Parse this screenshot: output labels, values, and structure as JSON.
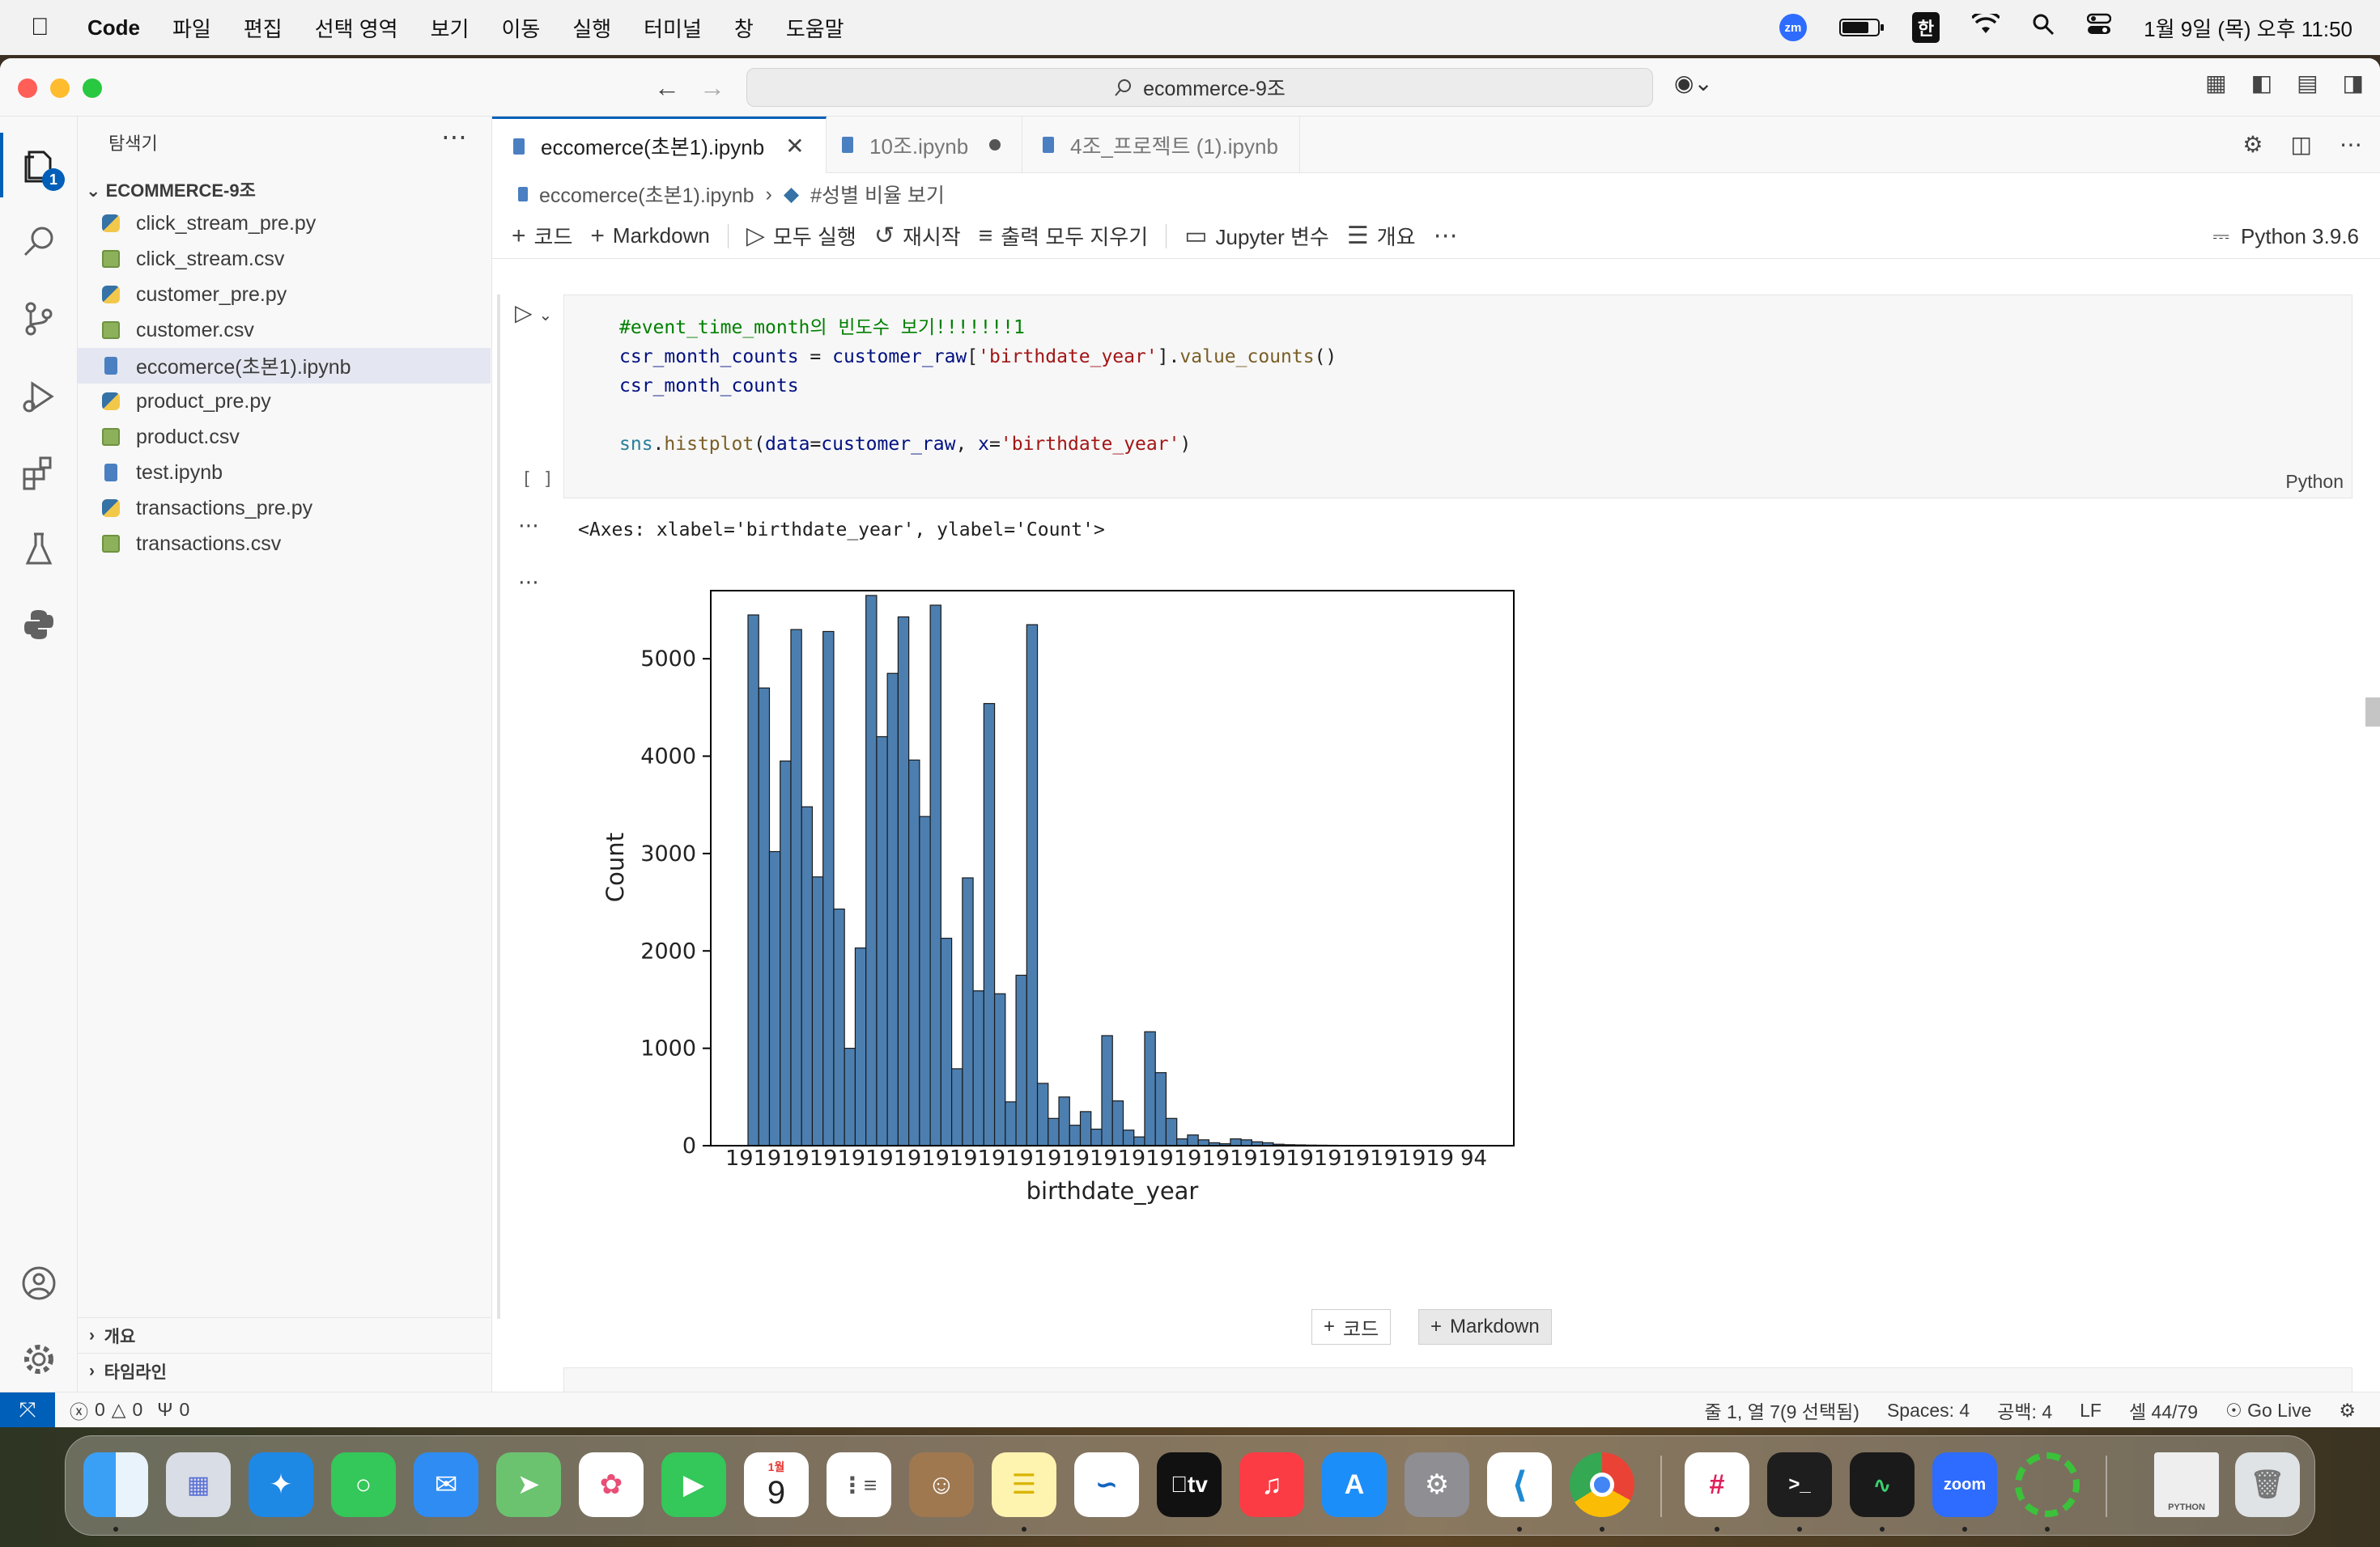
{
  "menubar": {
    "app": "Code",
    "items": [
      "파일",
      "편집",
      "선택 영역",
      "보기",
      "이동",
      "실행",
      "터미널",
      "창",
      "도움말"
    ],
    "zoom_badge": "zm",
    "input_method": "한",
    "datetime": "1월 9일 (목) 오후 11:50"
  },
  "titlebar": {
    "search": "ecommerce-9조"
  },
  "activity": {
    "explorer_badge": "1"
  },
  "sidebar": {
    "title": "탐색기",
    "folder": "ECOMMERCE-9조",
    "files": [
      {
        "name": "click_stream_pre.py",
        "type": "py"
      },
      {
        "name": "click_stream.csv",
        "type": "csv"
      },
      {
        "name": "customer_pre.py",
        "type": "py"
      },
      {
        "name": "customer.csv",
        "type": "csv"
      },
      {
        "name": "eccomerce(초본1).ipynb",
        "type": "nb"
      },
      {
        "name": "product_pre.py",
        "type": "py"
      },
      {
        "name": "product.csv",
        "type": "csv"
      },
      {
        "name": "test.ipynb",
        "type": "nb"
      },
      {
        "name": "transactions_pre.py",
        "type": "py"
      },
      {
        "name": "transactions.csv",
        "type": "csv"
      }
    ],
    "sections": [
      "개요",
      "타임라인"
    ]
  },
  "tabs": [
    {
      "label": "eccomerce(초본1).ipynb",
      "active": true
    },
    {
      "label": "10조.ipynb",
      "dirty": true
    },
    {
      "label": "4조_프로젝트 (1).ipynb"
    }
  ],
  "breadcrumb": {
    "file": "eccomerce(초본1).ipynb",
    "section": "#성별 비율 보기"
  },
  "toolbar": {
    "code": "코드",
    "markdown": "Markdown",
    "run_all": "모두 실행",
    "restart": "재시작",
    "clear_outputs": "출력 모두 지우기",
    "variables": "Jupyter 변수",
    "outline": "개요",
    "kernel": "Python 3.9.6"
  },
  "cell": {
    "line1": "#event_time_month의 빈도수 보기!!!!!!!1",
    "line2_var": "csr_month_counts",
    "line2_eq": " = ",
    "line2_obj": "customer_raw",
    "line2_open": "[",
    "line2_key": "'birthdate_year'",
    "line2_close": "].",
    "line2_fn": "value_counts",
    "line2_call": "()",
    "line3": "csr_month_counts",
    "line5_mod": "sns",
    "line5_dot": ".",
    "line5_fn": "histplot",
    "line5_a": "(",
    "line5_p1": "data",
    "line5_eq1": "=",
    "line5_v1": "customer_raw",
    "line5_comma": ", ",
    "line5_p2": "x",
    "line5_eq2": "=",
    "line5_v2": "'birthdate_year'",
    "line5_b": ")",
    "exec_count": "[ ]",
    "language": "Python",
    "output_text": "<Axes: xlabel='birthdate_year', ylabel='Count'>"
  },
  "add_cell": {
    "code": "코드",
    "markdown": "Markdown"
  },
  "chart_data": {
    "type": "bar",
    "xlabel": "birthdate_year",
    "ylabel": "Count",
    "ylim": [
      0,
      5500
    ],
    "yticks": [
      0,
      1000,
      2000,
      3000,
      4000,
      5000
    ],
    "x_tick_overlap_text": "19",
    "x_tick_last": "94",
    "bar_color": "#4c7fb0",
    "values": [
      5450,
      4700,
      3020,
      3950,
      5300,
      3480,
      2760,
      5280,
      2430,
      1000,
      2030,
      5650,
      4200,
      4850,
      5430,
      3960,
      3380,
      5550,
      2130,
      790,
      2750,
      1590,
      4540,
      1560,
      450,
      1750,
      5350,
      640,
      280,
      500,
      210,
      350,
      170,
      1130,
      460,
      160,
      90,
      1170,
      750,
      280,
      70,
      110,
      60,
      30,
      20,
      70,
      60,
      40,
      30,
      15,
      10,
      8,
      6,
      5,
      4,
      3,
      3,
      2,
      2,
      2,
      2,
      1,
      1,
      1,
      1,
      1
    ]
  },
  "statusbar": {
    "errors": "0",
    "warnings": "0",
    "ports": "0",
    "position": "줄 1, 열 7(9 선택됨)",
    "spaces": "Spaces: 4",
    "tab_size": "공백: 4",
    "eol": "LF",
    "cell": "셀 44/79",
    "golive": "Go Live"
  },
  "dock": {
    "calendar_month": "1월",
    "calendar_day": "9",
    "tv": "tv",
    "zoom": "zoom",
    "python_label": "PYTHON"
  }
}
